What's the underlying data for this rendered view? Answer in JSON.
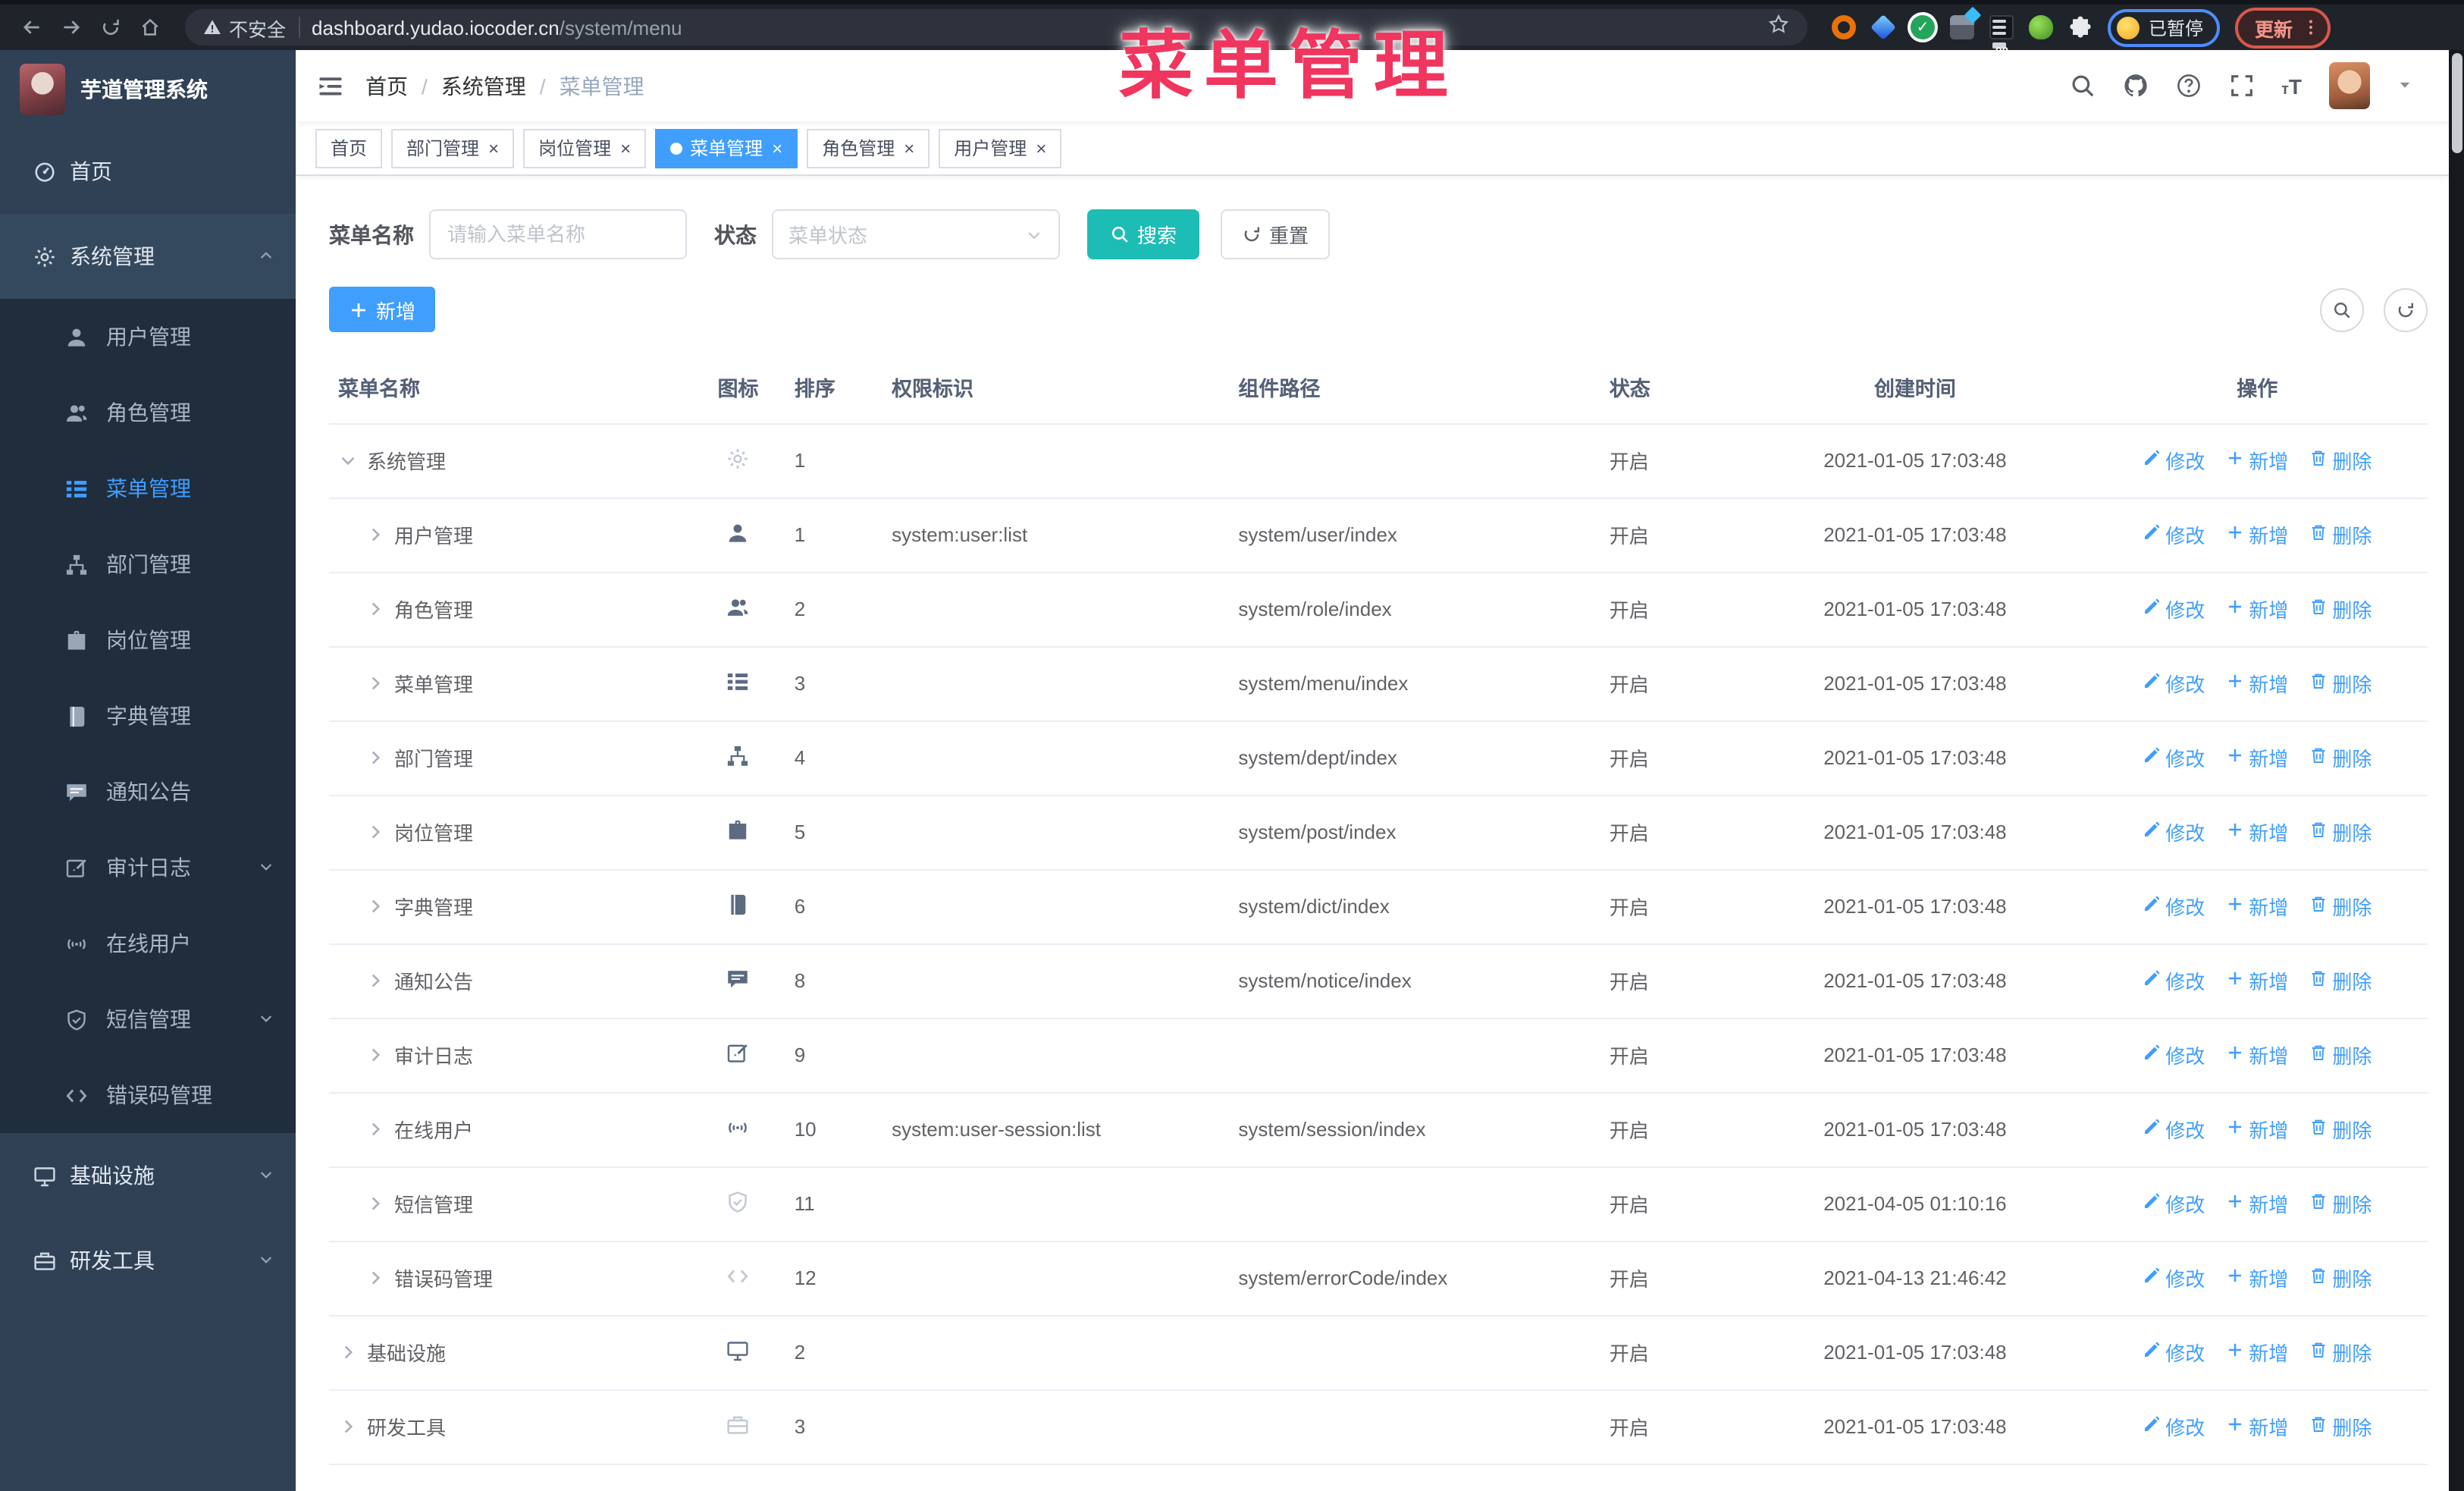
{
  "browser": {
    "security_label": "不安全",
    "url_host": "dashboard.yudao.iocoder.cn",
    "url_path": "/system/menu",
    "paused_label": "已暂停",
    "update_label": "更新",
    "on_badge": "on"
  },
  "annotation_text": "菜单管理",
  "sidebar": {
    "title": "芋道管理系统",
    "items": [
      {
        "label": "首页",
        "icon": "dashboard",
        "level": "top"
      },
      {
        "label": "系统管理",
        "icon": "gear",
        "level": "top",
        "chevron": "up",
        "open": true
      },
      {
        "label": "用户管理",
        "icon": "user",
        "level": "sub"
      },
      {
        "label": "角色管理",
        "icon": "users",
        "level": "sub"
      },
      {
        "label": "菜单管理",
        "icon": "tree-table",
        "level": "sub",
        "active": true
      },
      {
        "label": "部门管理",
        "icon": "tree",
        "level": "sub"
      },
      {
        "label": "岗位管理",
        "icon": "post",
        "level": "sub"
      },
      {
        "label": "字典管理",
        "icon": "dict",
        "level": "sub"
      },
      {
        "label": "通知公告",
        "icon": "message",
        "level": "sub"
      },
      {
        "label": "审计日志",
        "icon": "log",
        "level": "sub",
        "chevron": "down"
      },
      {
        "label": "在线用户",
        "icon": "online",
        "level": "sub"
      },
      {
        "label": "短信管理",
        "icon": "sms",
        "level": "sub",
        "chevron": "down"
      },
      {
        "label": "错误码管理",
        "icon": "code",
        "level": "sub"
      },
      {
        "label": "基础设施",
        "icon": "monitor",
        "level": "top",
        "chevron": "down"
      },
      {
        "label": "研发工具",
        "icon": "tool",
        "level": "top",
        "chevron": "down"
      }
    ]
  },
  "header": {
    "breadcrumb": [
      "首页",
      "系统管理",
      "菜单管理"
    ]
  },
  "tabs": [
    {
      "label": "首页",
      "closable": false,
      "active": false
    },
    {
      "label": "部门管理",
      "closable": true,
      "active": false
    },
    {
      "label": "岗位管理",
      "closable": true,
      "active": false
    },
    {
      "label": "菜单管理",
      "closable": true,
      "active": true
    },
    {
      "label": "角色管理",
      "closable": true,
      "active": false
    },
    {
      "label": "用户管理",
      "closable": true,
      "active": false
    }
  ],
  "filters": {
    "name_label": "菜单名称",
    "name_placeholder": "请输入菜单名称",
    "status_label": "状态",
    "status_placeholder": "菜单状态",
    "search_label": "搜索",
    "reset_label": "重置"
  },
  "toolbar": {
    "add_label": "新增"
  },
  "table": {
    "headers": [
      "菜单名称",
      "图标",
      "排序",
      "权限标识",
      "组件路径",
      "状态",
      "创建时间",
      "操作"
    ],
    "op_labels": {
      "edit": "修改",
      "add": "新增",
      "delete": "删除"
    },
    "rows": [
      {
        "name": "系统管理",
        "level": 0,
        "caret": "down",
        "icon": "gear",
        "icon_light": true,
        "sort": "1",
        "permission": "",
        "component": "",
        "status": "开启",
        "created": "2021-01-05 17:03:48"
      },
      {
        "name": "用户管理",
        "level": 1,
        "caret": "right",
        "icon": "user",
        "icon_light": false,
        "sort": "1",
        "permission": "system:user:list",
        "component": "system/user/index",
        "status": "开启",
        "created": "2021-01-05 17:03:48"
      },
      {
        "name": "角色管理",
        "level": 1,
        "caret": "right",
        "icon": "users",
        "icon_light": false,
        "sort": "2",
        "permission": "",
        "component": "system/role/index",
        "status": "开启",
        "created": "2021-01-05 17:03:48"
      },
      {
        "name": "菜单管理",
        "level": 1,
        "caret": "right",
        "icon": "tree-table",
        "icon_light": false,
        "sort": "3",
        "permission": "",
        "component": "system/menu/index",
        "status": "开启",
        "created": "2021-01-05 17:03:48"
      },
      {
        "name": "部门管理",
        "level": 1,
        "caret": "right",
        "icon": "tree",
        "icon_light": false,
        "sort": "4",
        "permission": "",
        "component": "system/dept/index",
        "status": "开启",
        "created": "2021-01-05 17:03:48"
      },
      {
        "name": "岗位管理",
        "level": 1,
        "caret": "right",
        "icon": "post",
        "icon_light": false,
        "sort": "5",
        "permission": "",
        "component": "system/post/index",
        "status": "开启",
        "created": "2021-01-05 17:03:48"
      },
      {
        "name": "字典管理",
        "level": 1,
        "caret": "right",
        "icon": "dict",
        "icon_light": false,
        "sort": "6",
        "permission": "",
        "component": "system/dict/index",
        "status": "开启",
        "created": "2021-01-05 17:03:48"
      },
      {
        "name": "通知公告",
        "level": 1,
        "caret": "right",
        "icon": "message",
        "icon_light": false,
        "sort": "8",
        "permission": "",
        "component": "system/notice/index",
        "status": "开启",
        "created": "2021-01-05 17:03:48"
      },
      {
        "name": "审计日志",
        "level": 1,
        "caret": "right",
        "icon": "log",
        "icon_light": false,
        "sort": "9",
        "permission": "",
        "component": "",
        "status": "开启",
        "created": "2021-01-05 17:03:48"
      },
      {
        "name": "在线用户",
        "level": 1,
        "caret": "right",
        "icon": "online",
        "icon_light": false,
        "sort": "10",
        "permission": "system:user-session:list",
        "component": "system/session/index",
        "status": "开启",
        "created": "2021-01-05 17:03:48"
      },
      {
        "name": "短信管理",
        "level": 1,
        "caret": "right",
        "icon": "sms",
        "icon_light": true,
        "sort": "11",
        "permission": "",
        "component": "",
        "status": "开启",
        "created": "2021-04-05 01:10:16"
      },
      {
        "name": "错误码管理",
        "level": 1,
        "caret": "right",
        "icon": "code",
        "icon_light": true,
        "sort": "12",
        "permission": "",
        "component": "system/errorCode/index",
        "status": "开启",
        "created": "2021-04-13 21:46:42"
      },
      {
        "name": "基础设施",
        "level": 0,
        "caret": "right",
        "icon": "monitor",
        "icon_light": false,
        "sort": "2",
        "permission": "",
        "component": "",
        "status": "开启",
        "created": "2021-01-05 17:03:48"
      },
      {
        "name": "研发工具",
        "level": 0,
        "caret": "right",
        "icon": "tool",
        "icon_light": true,
        "sort": "3",
        "permission": "",
        "component": "",
        "status": "开启",
        "created": "2021-01-05 17:03:48"
      }
    ]
  }
}
